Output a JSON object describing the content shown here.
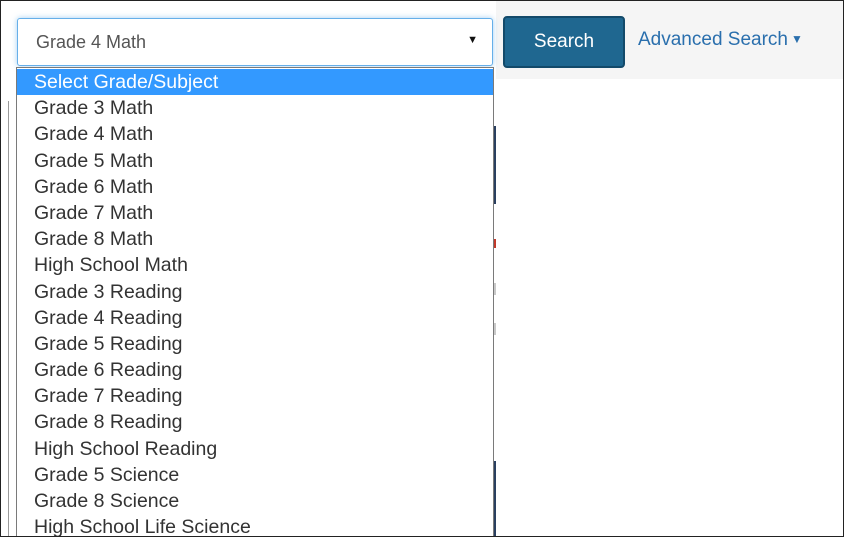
{
  "search_bar": {
    "selected_value": "Grade 4 Math",
    "search_label": "Search",
    "advanced_search_label": "Advanced Search"
  },
  "dropdown": {
    "options": [
      "Select Grade/Subject",
      "Grade 3 Math",
      "Grade 4 Math",
      "Grade 5 Math",
      "Grade 6 Math",
      "Grade 7 Math",
      "Grade 8 Math",
      "High School Math",
      "Grade 3 Reading",
      "Grade 4 Reading",
      "Grade 5 Reading",
      "Grade 6 Reading",
      "Grade 7 Reading",
      "Grade 8 Reading",
      "High School Reading",
      "Grade 5 Science",
      "Grade 8 Science",
      "High School Life Science"
    ],
    "highlighted_index": 0
  },
  "colors": {
    "highlight": "#3399ff",
    "button": "#1f6790",
    "link": "#2a6fad"
  }
}
